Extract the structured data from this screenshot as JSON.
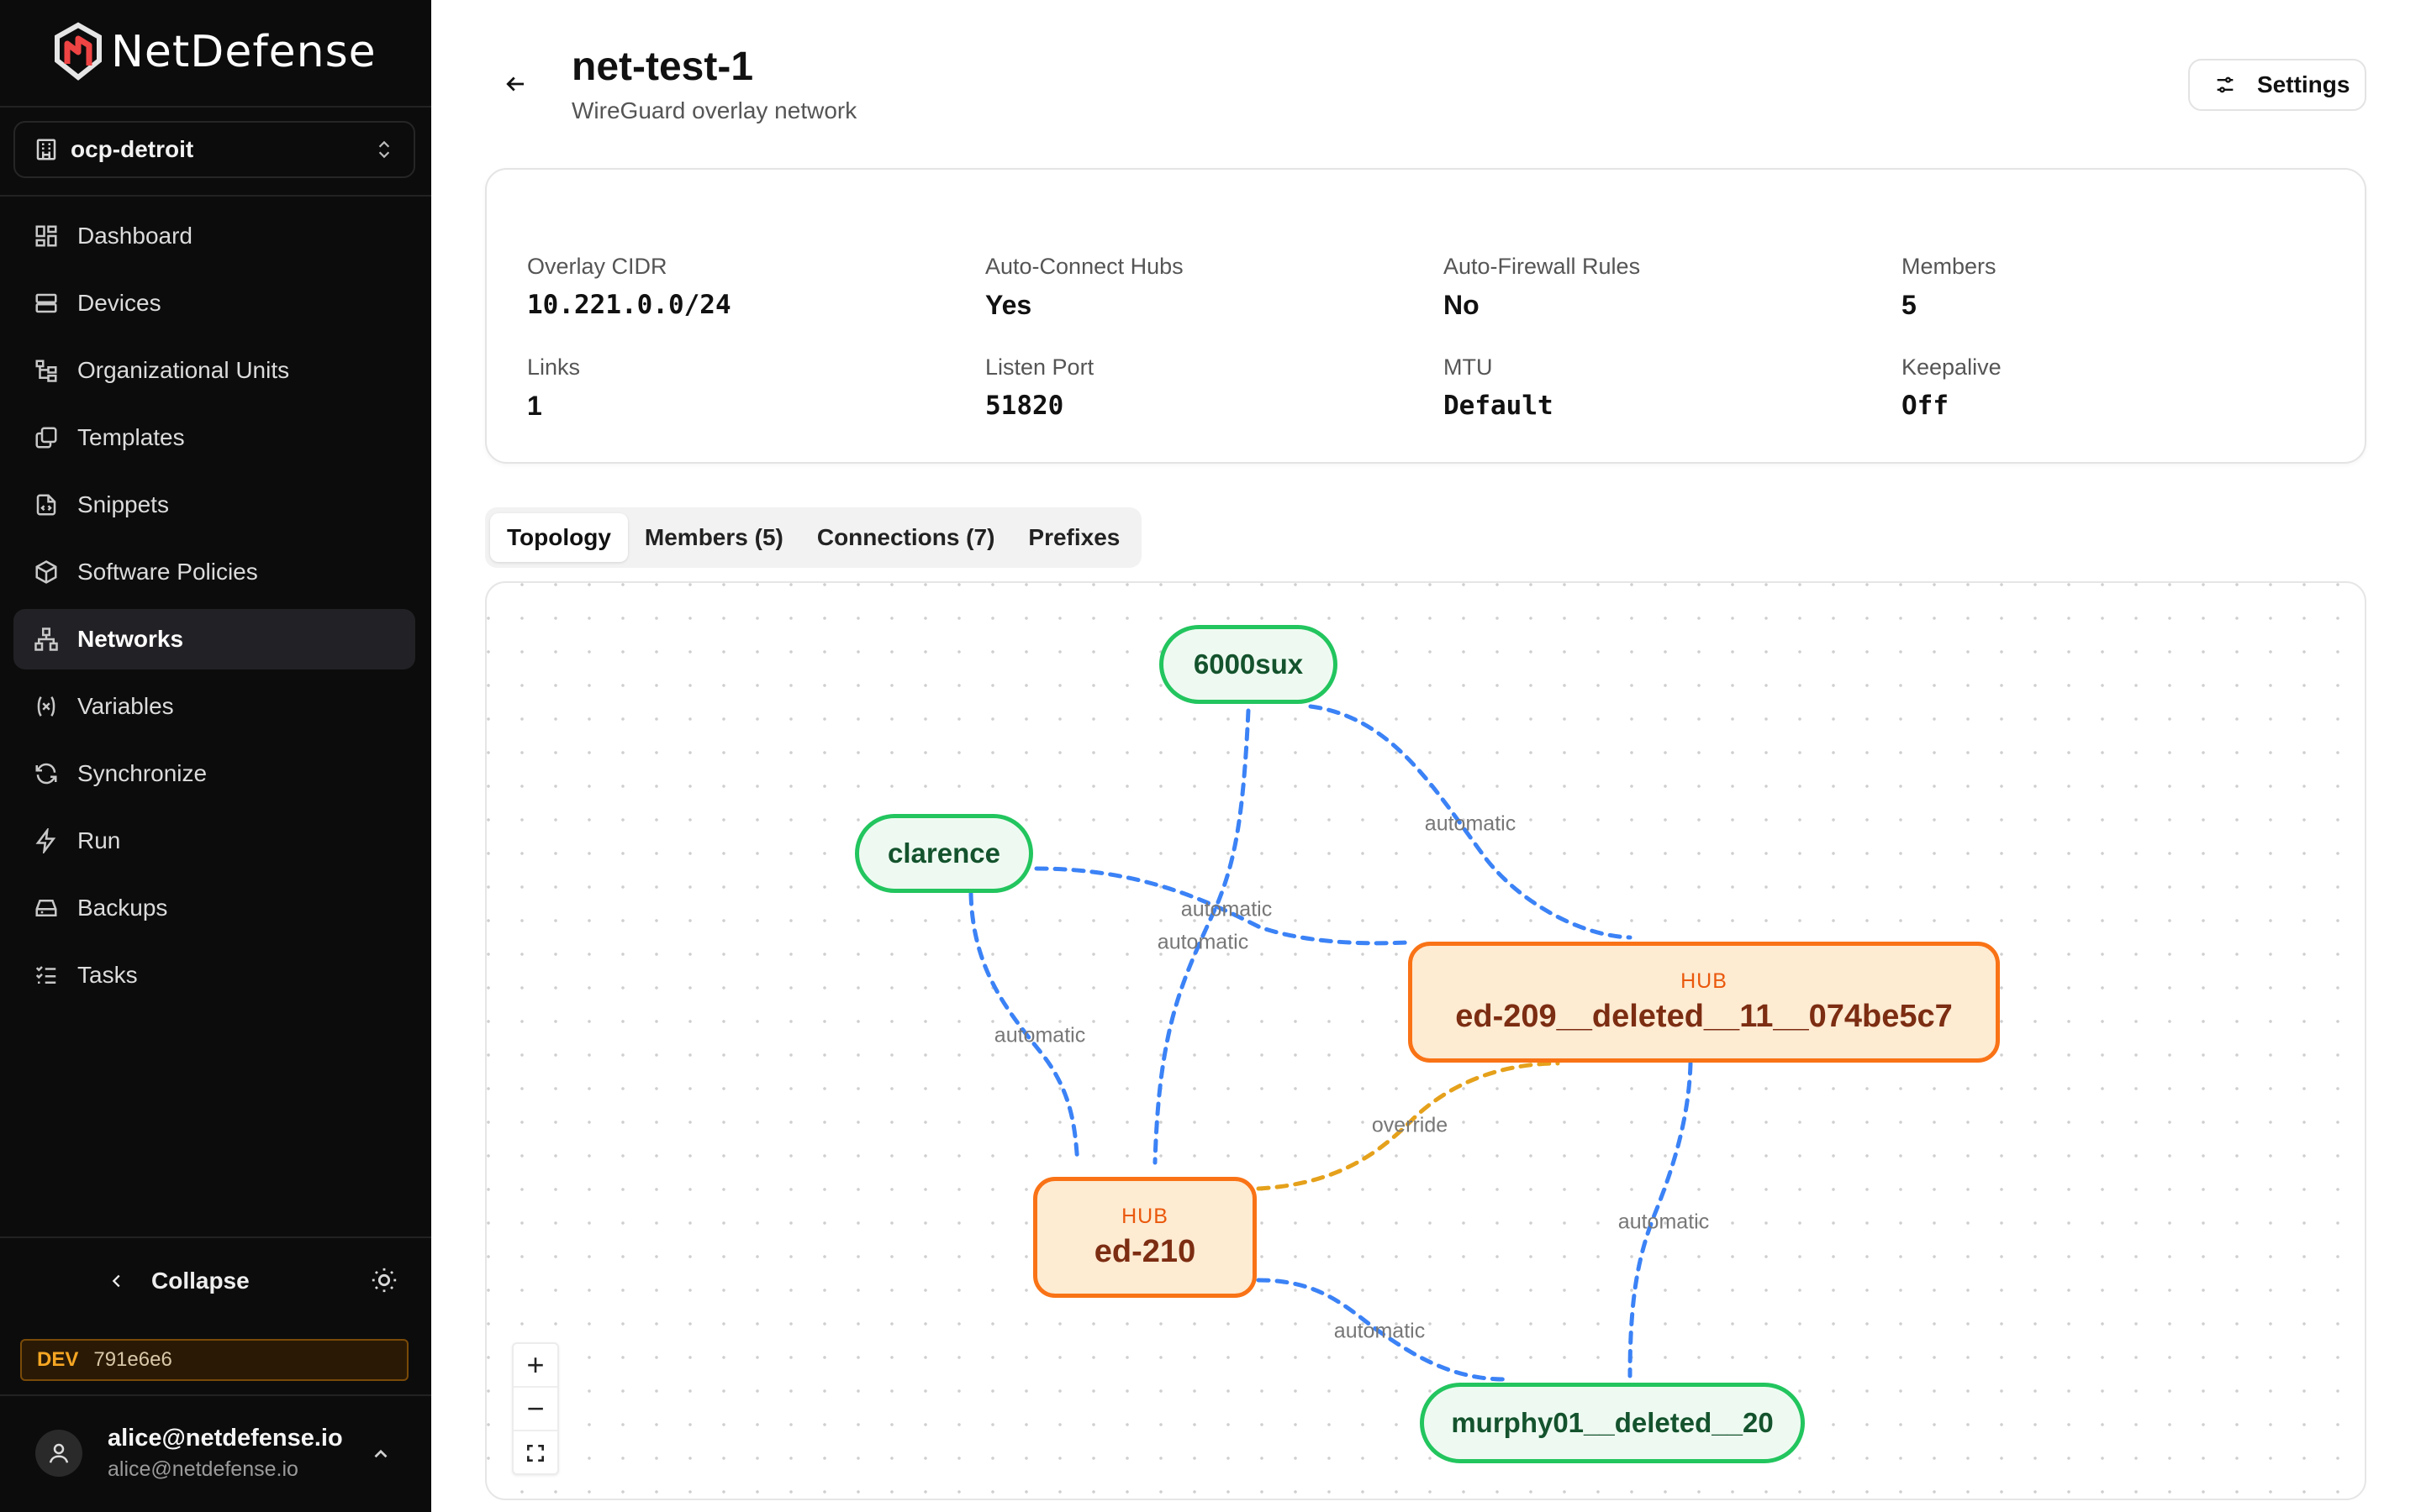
{
  "brand": {
    "name": "NetDefense"
  },
  "org": {
    "name": "ocp-detroit"
  },
  "nav": [
    {
      "label": "Dashboard",
      "icon": "dashboard-icon"
    },
    {
      "label": "Devices",
      "icon": "server-icon"
    },
    {
      "label": "Organizational Units",
      "icon": "hierarchy-icon"
    },
    {
      "label": "Templates",
      "icon": "copy-icon"
    },
    {
      "label": "Snippets",
      "icon": "code-file-icon"
    },
    {
      "label": "Software Policies",
      "icon": "package-icon"
    },
    {
      "label": "Networks",
      "icon": "network-icon",
      "active": true
    },
    {
      "label": "Variables",
      "icon": "variable-icon"
    },
    {
      "label": "Synchronize",
      "icon": "sync-icon"
    },
    {
      "label": "Run",
      "icon": "lightning-icon"
    },
    {
      "label": "Backups",
      "icon": "drive-icon"
    },
    {
      "label": "Tasks",
      "icon": "list-check-icon"
    }
  ],
  "sidebar_footer": {
    "collapse_label": "Collapse",
    "env_tag": "DEV",
    "env_hash": "791e6e6",
    "user_name": "alice@netdefense.io",
    "user_email": "alice@netdefense.io"
  },
  "header": {
    "title": "net-test-1",
    "subtitle": "WireGuard overlay network",
    "settings_label": "Settings"
  },
  "stats": {
    "overlay_cidr": {
      "label": "Overlay CIDR",
      "value": "10.221.0.0/24"
    },
    "auto_connect_hubs": {
      "label": "Auto-Connect Hubs",
      "value": "Yes"
    },
    "auto_firewall_rules": {
      "label": "Auto-Firewall Rules",
      "value": "No"
    },
    "members": {
      "label": "Members",
      "value": "5"
    },
    "links": {
      "label": "Links",
      "value": "1"
    },
    "listen_port": {
      "label": "Listen Port",
      "value": "51820"
    },
    "mtu": {
      "label": "MTU",
      "value": "Default"
    },
    "keepalive": {
      "label": "Keepalive",
      "value": "Off"
    }
  },
  "tabs": [
    {
      "label": "Topology",
      "active": true
    },
    {
      "label": "Members (5)"
    },
    {
      "label": "Connections (7)"
    },
    {
      "label": "Prefixes"
    }
  ],
  "topology": {
    "nodes": {
      "n6000sux": {
        "name": "6000sux",
        "type": "member"
      },
      "clarence": {
        "name": "clarence",
        "type": "member"
      },
      "ed209": {
        "name": "ed-209__deleted__11__074be5c7",
        "type": "hub",
        "tag": "HUB"
      },
      "ed210": {
        "name": "ed-210",
        "type": "hub",
        "tag": "HUB"
      },
      "murphy": {
        "name": "murphy01__deleted__20",
        "type": "member"
      }
    },
    "edges": {
      "e1": {
        "label": "automatic",
        "from": "6000sux",
        "to": "ed-209__deleted__11__074be5c7"
      },
      "e2": {
        "label": "automatic",
        "from": "6000sux",
        "to": "ed-210"
      },
      "e3": {
        "label": "automatic",
        "from": "clarence",
        "to": "ed-209__deleted__11__074be5c7"
      },
      "e4": {
        "label": "automatic",
        "from": "clarence",
        "to": "ed-210"
      },
      "e5": {
        "label": "override",
        "from": "ed-210",
        "to": "ed-209__deleted__11__074be5c7"
      },
      "e6": {
        "label": "automatic",
        "from": "ed-209__deleted__11__074be5c7",
        "to": "murphy01__deleted__20"
      },
      "e7": {
        "label": "automatic",
        "from": "ed-210",
        "to": "murphy01__deleted__20"
      }
    },
    "colors": {
      "automatic": "#3b82f6",
      "override": "#eab308",
      "member": "#22c55e",
      "hub": "#f97316"
    },
    "zoom_controls": {
      "zoom_in": "+",
      "zoom_out": "−",
      "fit": "fit-view-icon"
    }
  }
}
